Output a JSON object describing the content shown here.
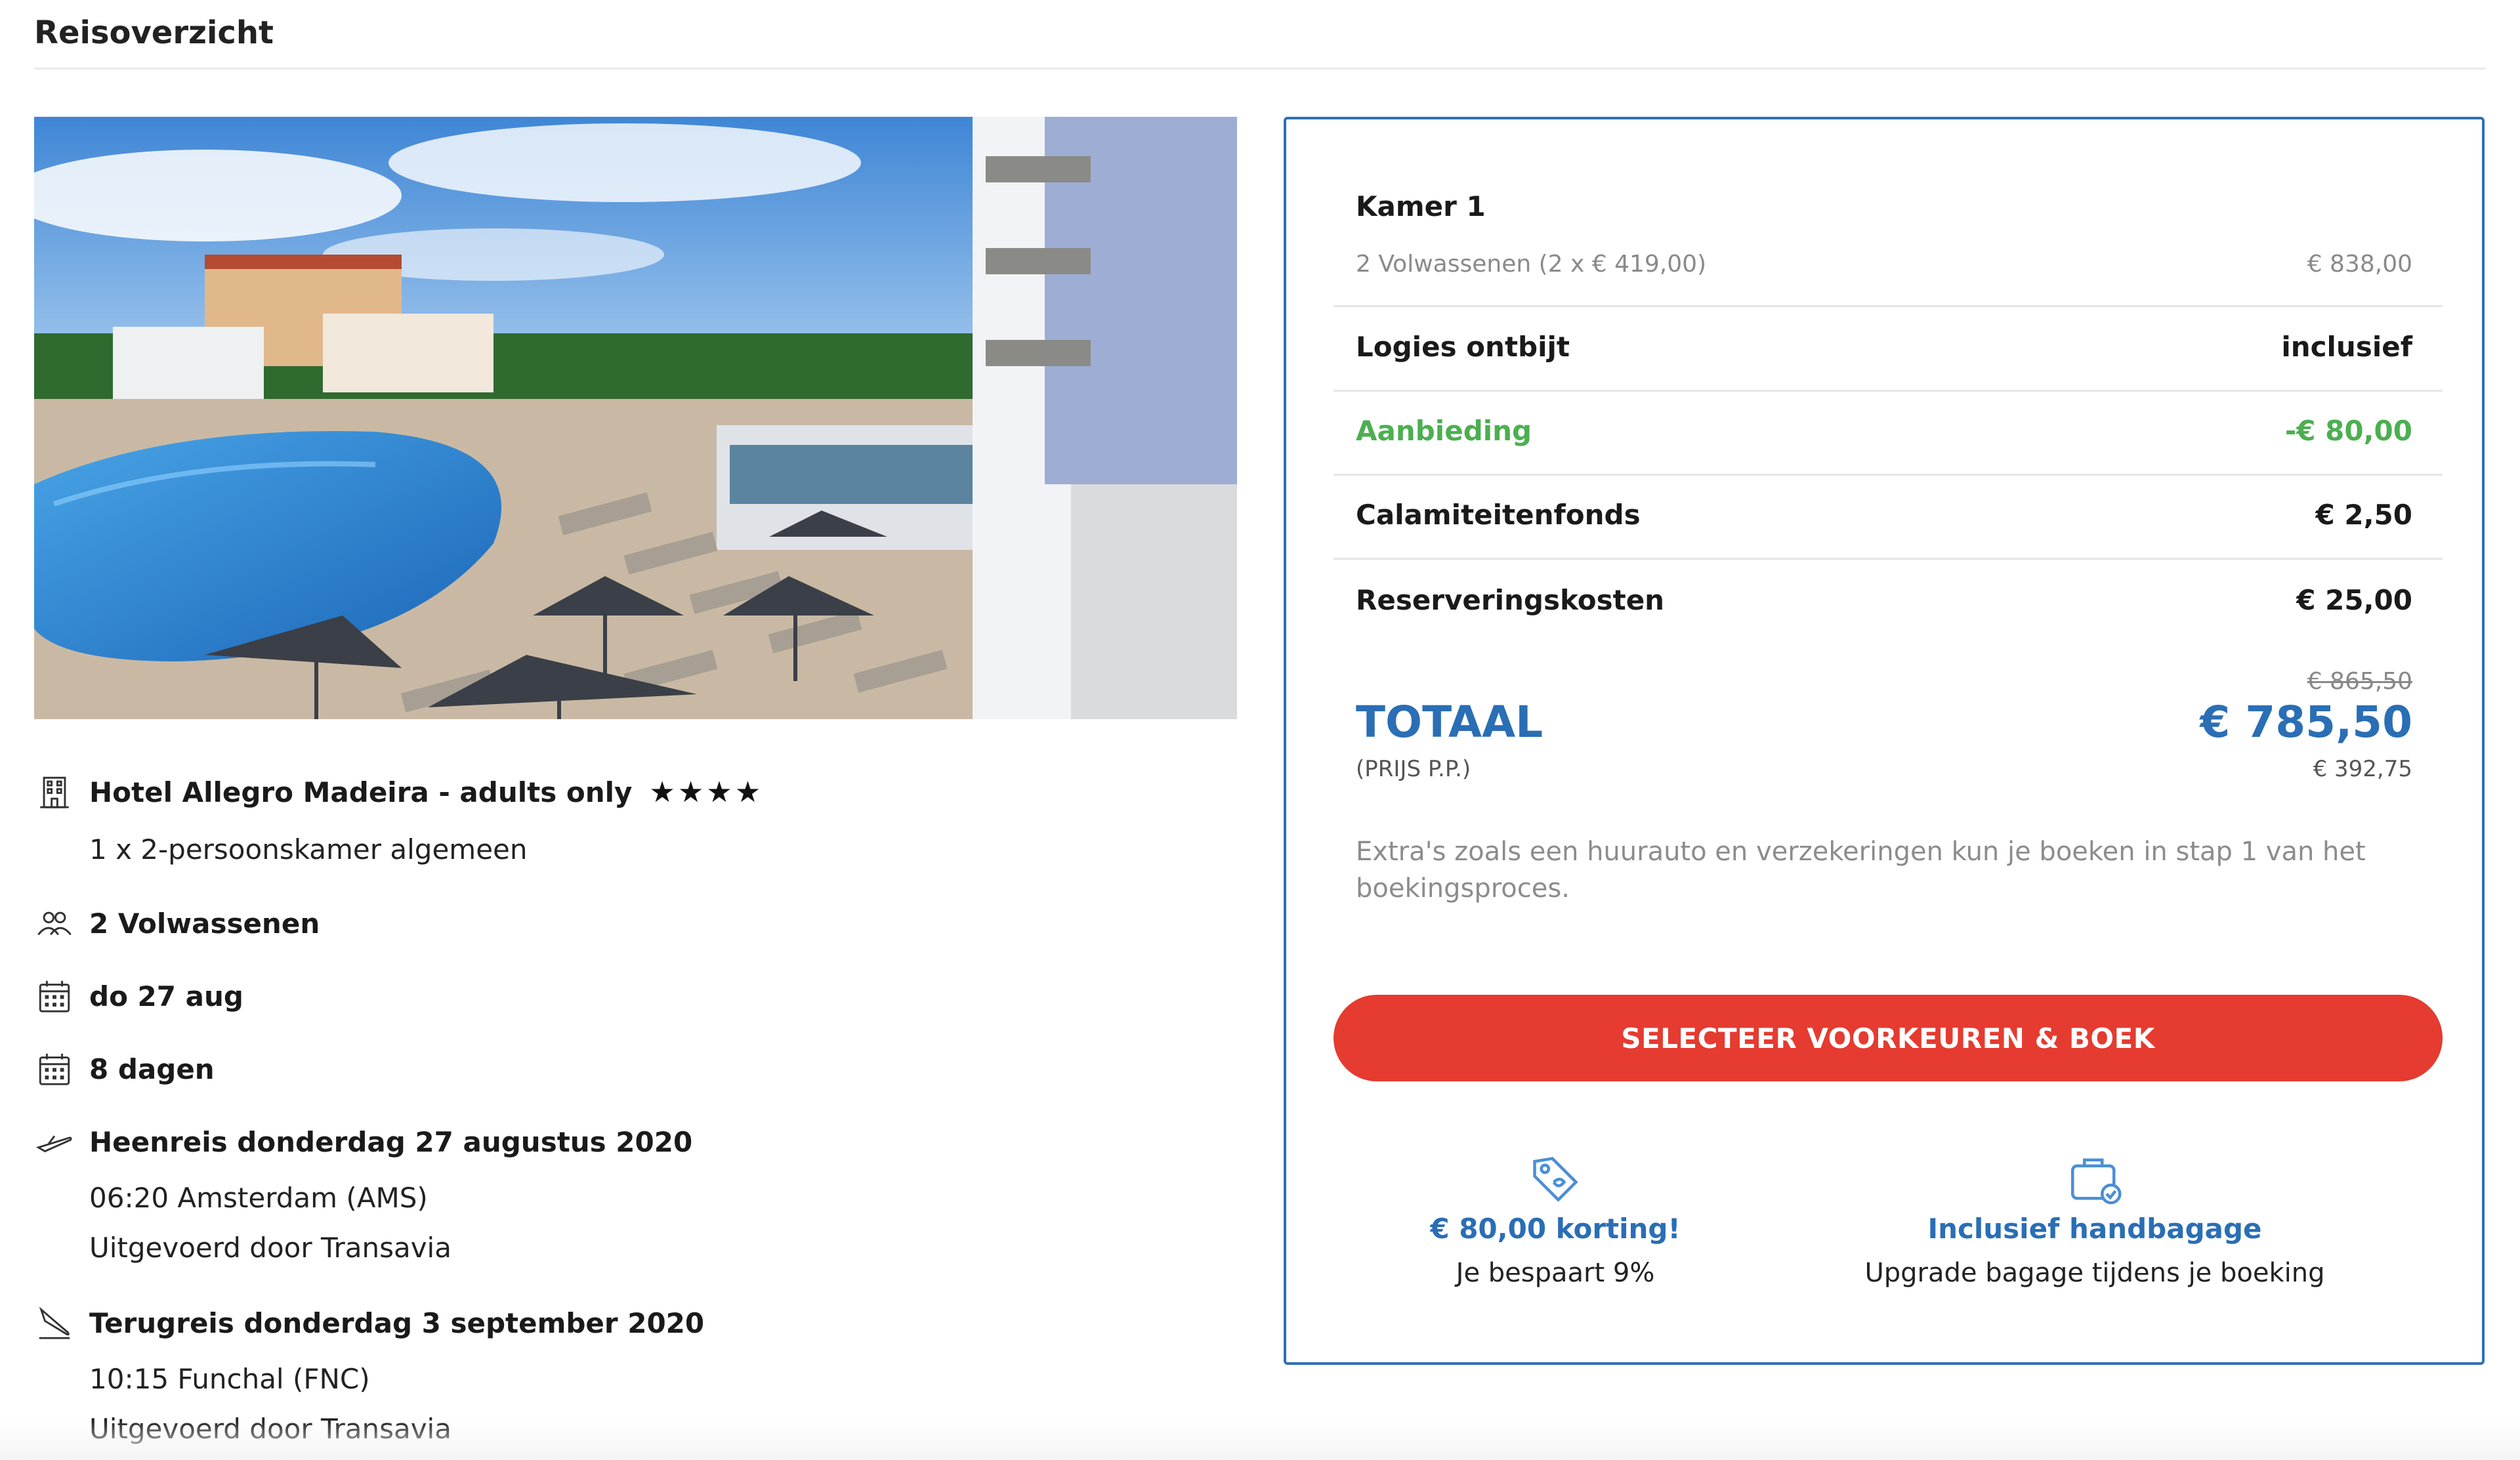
{
  "page": {
    "title": "Reisoverzicht"
  },
  "hotel": {
    "name": "Hotel Allegro Madeira - adults only",
    "stars": 4,
    "stars_glyphs": "★★★★",
    "room": "1 x 2-persoonskamer algemeen",
    "photo_icon": "hotel-photo"
  },
  "travel": {
    "travelers": "2 Volwassenen",
    "date": "do 27 aug",
    "duration": "8 dagen",
    "outbound": {
      "title": "Heenreis donderdag 27 augustus 2020",
      "departure": "06:20 Amsterdam (AMS)",
      "operator": "Uitgevoerd door Transavia"
    },
    "return": {
      "title": "Terugreis donderdag 3 september 2020",
      "departure": "10:15 Funchal (FNC)",
      "operator": "Uitgevoerd door Transavia"
    }
  },
  "icons": {
    "hotel": "building-icon",
    "travelers": "people-icon",
    "date": "calendar-icon",
    "duration": "calendar-icon",
    "outbound": "plane-takeoff-icon",
    "return": "plane-landing-icon",
    "discount": "price-tag-icon",
    "baggage": "suitcase-check-icon"
  },
  "price": {
    "room_title": "Kamer 1",
    "room_detail": "2 Volwassenen (2 x € 419,00)",
    "room_amount": "€ 838,00",
    "lines": [
      {
        "label": "Logies ontbijt",
        "value": "inclusief"
      },
      {
        "label": "Aanbieding",
        "value": "-€ 80,00"
      },
      {
        "label": "Calamiteitenfonds",
        "value": "€ 2,50"
      },
      {
        "label": "Reserveringskosten",
        "value": "€ 25,00"
      }
    ],
    "old_total": "€ 865,50",
    "total_label": "TOTAAL",
    "total_value": "€ 785,50",
    "pp_label": "(PRIJS P.P.)",
    "pp_value": "€ 392,75",
    "extras_note": "Extra's zoals een huurauto en verzekeringen kun je boeken in stap 1 van het boekingsproces."
  },
  "cta": {
    "label": "SELECTEER VOORKEUREN & BOEK"
  },
  "perks": [
    {
      "title": "€ 80,00 korting!",
      "sub": "Je bespaart 9%"
    },
    {
      "title": "Inclusief handbagage",
      "sub": "Upgrade bagage tijdens je boeking"
    }
  ],
  "colors": {
    "accent_blue": "#2a6eb5",
    "card_border": "#2e6fb7",
    "cta_red": "#e53b30",
    "discount_green": "#4caf50"
  }
}
